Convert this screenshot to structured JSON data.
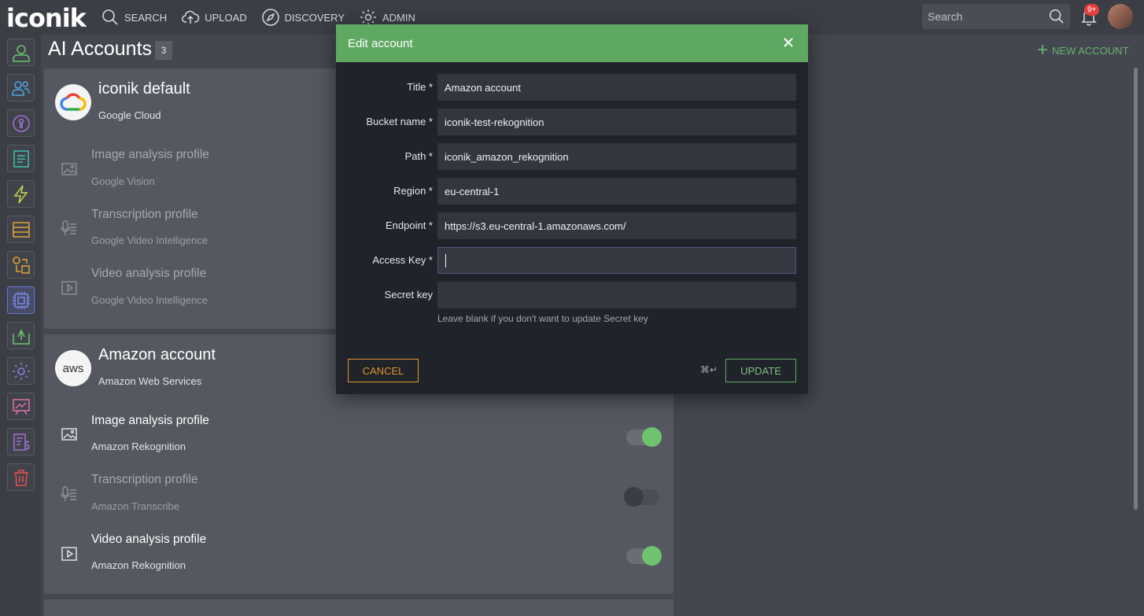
{
  "app": {
    "logo": "iconik"
  },
  "nav": {
    "search": "SEARCH",
    "upload": "UPLOAD",
    "discovery": "DISCOVERY",
    "admin": "ADMIN"
  },
  "top_search": {
    "placeholder": "Search"
  },
  "notifications": {
    "badge": "9+"
  },
  "page": {
    "title": "AI Accounts",
    "count": "3",
    "new_account": "NEW ACCOUNT"
  },
  "accounts": [
    {
      "title": "iconik default",
      "provider": "Google Cloud",
      "logo_icon": "google-cloud-icon",
      "profiles": [
        {
          "title": "Image analysis profile",
          "service": "Google Vision"
        },
        {
          "title": "Transcription profile",
          "service": "Google Video Intelligence"
        },
        {
          "title": "Video analysis profile",
          "service": "Google Video Intelligence"
        }
      ]
    },
    {
      "title": "Amazon account",
      "provider": "Amazon Web Services",
      "logo_text": "aws",
      "profiles": [
        {
          "title": "Image analysis profile",
          "service": "Amazon Rekognition",
          "enabled": true
        },
        {
          "title": "Transcription profile",
          "service": "Amazon Transcribe",
          "enabled": false
        },
        {
          "title": "Video analysis profile",
          "service": "Amazon Rekognition",
          "enabled": true
        }
      ]
    }
  ],
  "modal": {
    "title": "Edit account",
    "fields": [
      {
        "label": "Title *",
        "value": "Amazon account"
      },
      {
        "label": "Bucket name *",
        "value": "iconik-test-rekognition"
      },
      {
        "label": "Path *",
        "value": "iconik_amazon_rekognition"
      },
      {
        "label": "Region *",
        "value": "eu-central-1"
      },
      {
        "label": "Endpoint *",
        "value": "https://s3.eu-central-1.amazonaws.com/"
      },
      {
        "label": "Access Key *",
        "value": ""
      },
      {
        "label": "Secret key",
        "value": ""
      }
    ],
    "hint": "Leave blank if you don't want to update Secret key",
    "cancel": "CANCEL",
    "shortcut": "⌘↵",
    "update": "UPDATE"
  },
  "colors": {
    "accent_green": "#5fa862",
    "cancel_orange": "#e0932b",
    "active_sidebar": "#6b79d6",
    "badge_red": "#e53e3e"
  }
}
